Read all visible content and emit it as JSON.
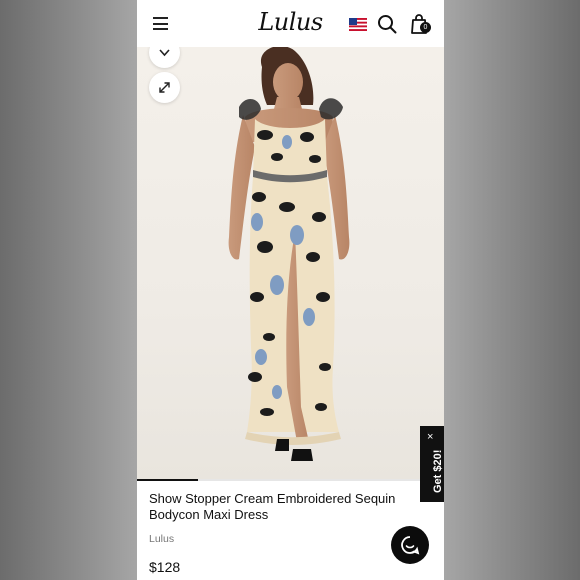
{
  "header": {
    "logo": "Lulus",
    "cart_count": "0"
  },
  "product": {
    "title": "Show Stopper Cream Embroidered Sequin Bodycon Maxi Dress",
    "brand": "Lulus",
    "price": "$128"
  },
  "promo": {
    "label": "Get $20!",
    "close": "×"
  },
  "icons": {
    "menu": "hamburger-icon",
    "flag": "us-flag-icon",
    "search": "search-icon",
    "bag": "shopping-bag-icon",
    "chevron": "chevron-down-icon",
    "expand": "expand-icon",
    "chat": "chat-icon"
  },
  "colors": {
    "background_blur": "#7d7d7d",
    "text": "#111111",
    "muted": "#777777",
    "accent_dark": "#0c0c0c"
  }
}
